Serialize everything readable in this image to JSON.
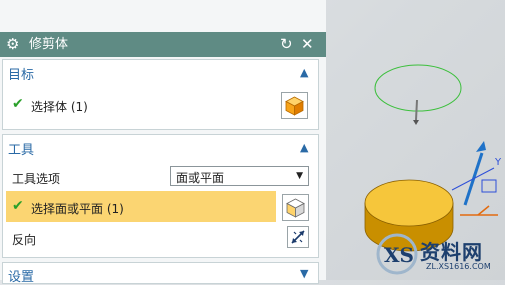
{
  "dialog": {
    "title": "修剪体",
    "gear_icon": "⚙",
    "reset_icon": "↻",
    "close_icon": "✕"
  },
  "target": {
    "header": "目标",
    "select_body_label": "选择体 (1)"
  },
  "tool": {
    "header": "工具",
    "tool_option_label": "工具选项",
    "tool_option_value": "面或平面",
    "select_face_label": "选择面或平面 (1)",
    "reverse_label": "反向"
  },
  "settings": {
    "header": "设置"
  },
  "scene": {
    "axis_label": "Y"
  },
  "watermark": {
    "text": "资料网",
    "url": "ZL.XS1616.COM"
  },
  "colors": {
    "titlebar": "#5f8b84",
    "accent": "#2a6aa6",
    "highlight": "#fbd572",
    "check": "#2aa02a",
    "cube": "#f7a41a"
  }
}
